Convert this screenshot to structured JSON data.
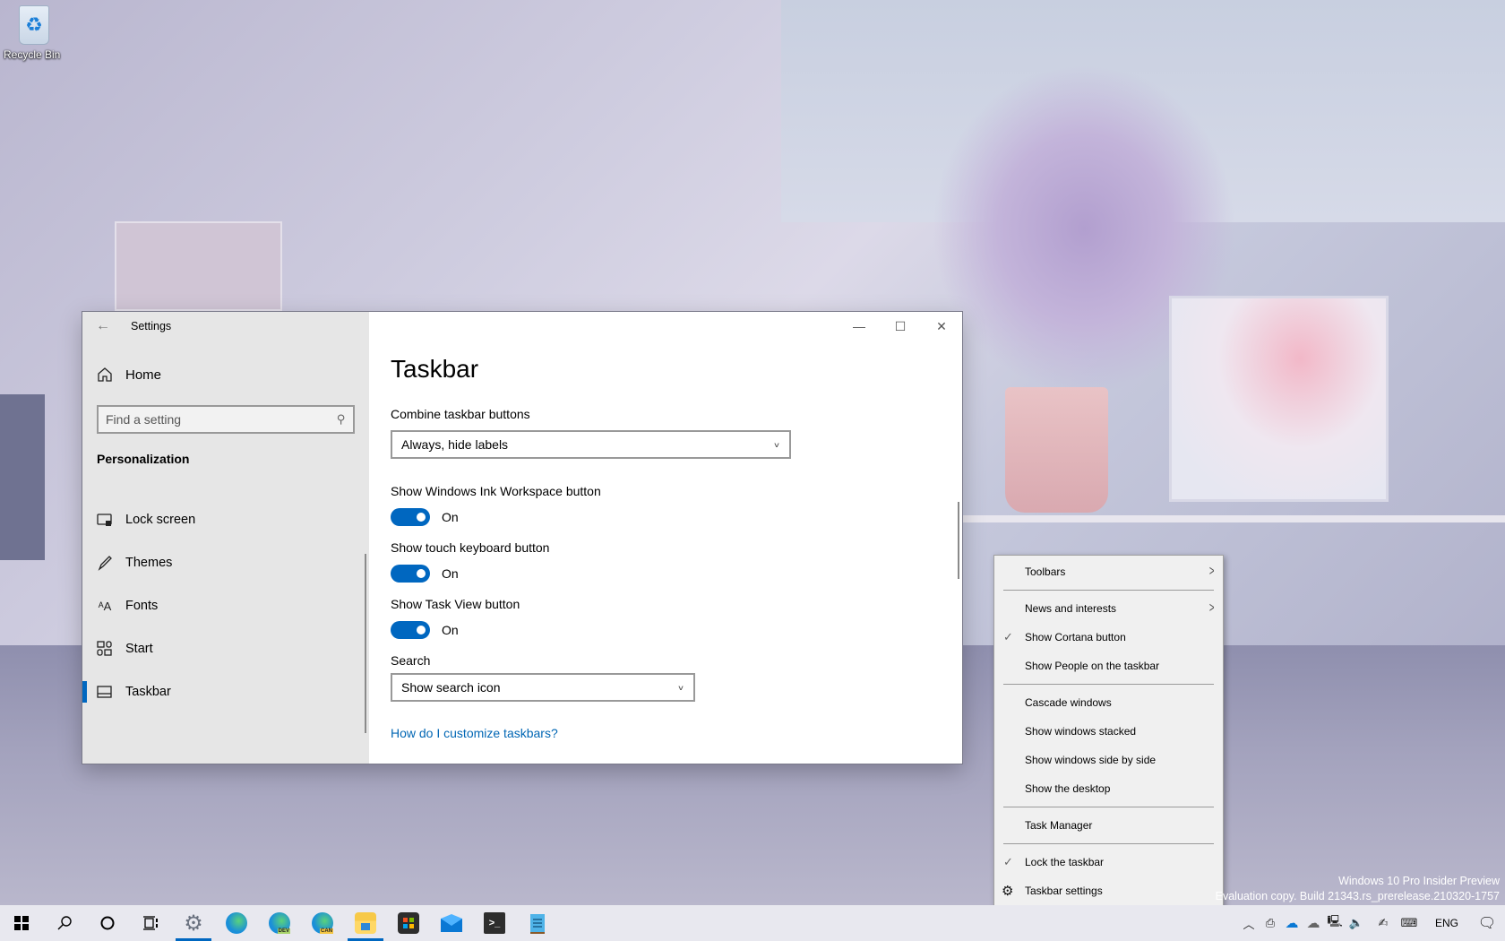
{
  "desktop": {
    "icons": [
      {
        "label": "Recycle Bin",
        "icon": "recycle-bin-icon"
      }
    ],
    "watermark": {
      "line1": "Windows 10 Pro Insider Preview",
      "line2": "Evaluation copy. Build 21343.rs_prerelease.210320-1757"
    }
  },
  "window": {
    "title": "Settings",
    "controls": {
      "minimize": "—",
      "maximize": "☐",
      "close": "✕"
    },
    "sidebar": {
      "home_label": "Home",
      "search_placeholder": "Find a setting",
      "section_title": "Personalization",
      "items": [
        {
          "label": "Lock screen",
          "icon": "lock-screen-icon",
          "active": false
        },
        {
          "label": "Themes",
          "icon": "brush-icon",
          "active": false
        },
        {
          "label": "Fonts",
          "icon": "fonts-icon",
          "active": false
        },
        {
          "label": "Start",
          "icon": "start-icon",
          "active": false
        },
        {
          "label": "Taskbar",
          "icon": "taskbar-icon",
          "active": true
        }
      ]
    },
    "main": {
      "page_title": "Taskbar",
      "combine": {
        "label": "Combine taskbar buttons",
        "value": "Always, hide labels"
      },
      "toggles": [
        {
          "label": "Show Windows Ink Workspace button",
          "state": "On",
          "on": true
        },
        {
          "label": "Show touch keyboard button",
          "state": "On",
          "on": true
        },
        {
          "label": "Show Task View button",
          "state": "On",
          "on": true
        }
      ],
      "search": {
        "label": "Search",
        "value": "Show search icon"
      },
      "help_link": "How do I customize taskbars?"
    }
  },
  "context_menu": {
    "items": [
      {
        "label": "Toolbars",
        "submenu": true
      },
      {
        "separator": true
      },
      {
        "label": "News and interests",
        "submenu": true
      },
      {
        "label": "Show Cortana button",
        "checked": true
      },
      {
        "label": "Show People on the taskbar"
      },
      {
        "separator": true
      },
      {
        "label": "Cascade windows"
      },
      {
        "label": "Show windows stacked"
      },
      {
        "label": "Show windows side by side"
      },
      {
        "label": "Show the desktop"
      },
      {
        "separator": true
      },
      {
        "label": "Task Manager"
      },
      {
        "separator": true
      },
      {
        "label": "Lock the taskbar",
        "checked": true
      },
      {
        "label": "Taskbar settings",
        "gear": true
      }
    ]
  },
  "taskbar": {
    "pinned": [
      {
        "name": "start",
        "icon": "windows-start-icon"
      },
      {
        "name": "search",
        "icon": "search-icon"
      },
      {
        "name": "cortana",
        "icon": "cortana-icon"
      },
      {
        "name": "task-view",
        "icon": "task-view-icon"
      },
      {
        "name": "settings",
        "icon": "settings-gear-icon",
        "running": true
      },
      {
        "name": "edge",
        "icon": "edge-icon"
      },
      {
        "name": "edge-dev",
        "icon": "edge-dev-icon",
        "badge": "DEV"
      },
      {
        "name": "edge-canary",
        "icon": "edge-canary-icon",
        "badge": "CAN"
      },
      {
        "name": "file-explorer",
        "icon": "file-explorer-icon",
        "running": true
      },
      {
        "name": "store",
        "icon": "store-icon"
      },
      {
        "name": "mail",
        "icon": "mail-icon"
      },
      {
        "name": "terminal",
        "icon": "terminal-icon"
      },
      {
        "name": "notepad",
        "icon": "notepad-icon"
      }
    ],
    "tray": {
      "icons": [
        "chevron-up-icon",
        "meet-now-icon",
        "onedrive-icon",
        "onedrive-personal-icon",
        "network-icon",
        "volume-icon",
        "pen-icon",
        "touch-keyboard-icon"
      ],
      "language": "ENG",
      "notification_icon": "action-center-icon"
    }
  }
}
